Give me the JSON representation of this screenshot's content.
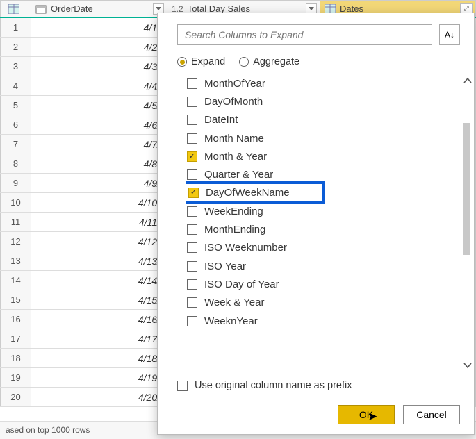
{
  "grid": {
    "columns": [
      {
        "label": "OrderDate",
        "type": "date"
      },
      {
        "label": "Total Day Sales",
        "type": "number"
      },
      {
        "label": "Dates",
        "type": "table"
      }
    ],
    "date_prefix": "4/",
    "row_count": 20
  },
  "popup": {
    "search_placeholder": "Search Columns to Expand",
    "radio_expand": "Expand",
    "radio_aggregate": "Aggregate",
    "columns": [
      {
        "label": "MonthOfYear",
        "checked": false
      },
      {
        "label": "DayOfMonth",
        "checked": false
      },
      {
        "label": "DateInt",
        "checked": false
      },
      {
        "label": "Month Name",
        "checked": false
      },
      {
        "label": "Month & Year",
        "checked": true
      },
      {
        "label": "Quarter & Year",
        "checked": false
      },
      {
        "label": "DayOfWeekName",
        "checked": true,
        "highlight": true
      },
      {
        "label": "WeekEnding",
        "checked": false
      },
      {
        "label": "MonthEnding",
        "checked": false
      },
      {
        "label": "ISO Weeknumber",
        "checked": false
      },
      {
        "label": "ISO Year",
        "checked": false
      },
      {
        "label": "ISO Day of Year",
        "checked": false
      },
      {
        "label": "Week & Year",
        "checked": false
      },
      {
        "label": "WeeknYear",
        "checked": false
      }
    ],
    "prefix_label": "Use original column name as prefix",
    "ok_label": "OK",
    "cancel_label": "Cancel"
  },
  "status": "ased on top 1000 rows"
}
